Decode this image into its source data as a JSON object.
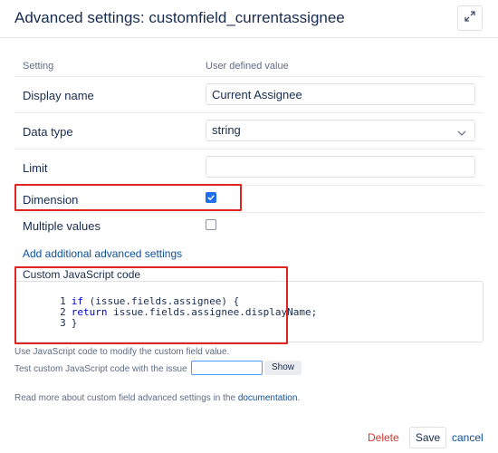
{
  "dialog": {
    "title": "Advanced settings: customfield_currentassignee",
    "expand_icon": "expand-arrows-icon"
  },
  "table": {
    "col_setting": "Setting",
    "col_value": "User defined value",
    "rows": {
      "display_name": {
        "label": "Display name",
        "value": "Current Assignee"
      },
      "data_type": {
        "label": "Data type",
        "value": "string"
      },
      "limit": {
        "label": "Limit",
        "value": ""
      },
      "dimension": {
        "label": "Dimension",
        "checked": true
      },
      "multiple_values": {
        "label": "Multiple values",
        "checked": false
      }
    }
  },
  "add_settings_link": "Add additional advanced settings",
  "code": {
    "label": "Custom JavaScript code",
    "lines": [
      {
        "num": "1",
        "keyword": "if",
        "rest": " (issue.fields.assignee) {"
      },
      {
        "num": "2",
        "keyword": "return",
        "rest": " issue.fields.assignee.displayName;"
      },
      {
        "num": "3",
        "keyword": "",
        "rest": "}"
      }
    ]
  },
  "help": {
    "modify_text": "Use JavaScript code to modify the custom field value.",
    "test_text": "Test custom JavaScript code with the issue",
    "test_input_value": "",
    "show_button": "Show",
    "readmore_prefix": "Read more about custom field advanced settings in the ",
    "readmore_link": "documentation",
    "readmore_suffix": "."
  },
  "footer": {
    "delete_label": "Delete",
    "save_label": "Save",
    "cancel_label": "cancel"
  },
  "colors": {
    "highlight": "#e0241f",
    "checkbox_on": "#1f6feb",
    "link": "#0b4f9c",
    "delete": "#d2362f"
  }
}
